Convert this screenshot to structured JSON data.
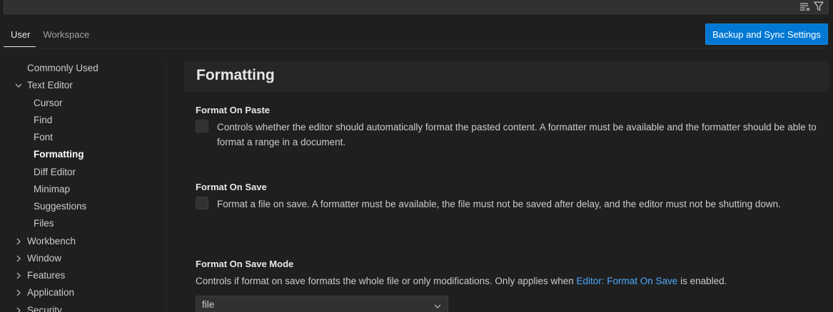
{
  "search": {
    "value": "",
    "clear_icon": "clear-filter-icon",
    "filter_icon": "filter-icon"
  },
  "tabs": [
    {
      "label": "User",
      "active": true
    },
    {
      "label": "Workspace",
      "active": false
    }
  ],
  "sync_button": {
    "label": "Backup and Sync Settings"
  },
  "toc": {
    "items": [
      {
        "label": "Commonly Used",
        "level": 0,
        "expandable": false
      },
      {
        "label": "Text Editor",
        "level": 0,
        "expandable": true,
        "expanded": true
      },
      {
        "label": "Cursor",
        "level": 1
      },
      {
        "label": "Find",
        "level": 1
      },
      {
        "label": "Font",
        "level": 1
      },
      {
        "label": "Formatting",
        "level": 1,
        "selected": true
      },
      {
        "label": "Diff Editor",
        "level": 1
      },
      {
        "label": "Minimap",
        "level": 1
      },
      {
        "label": "Suggestions",
        "level": 1
      },
      {
        "label": "Files",
        "level": 1
      },
      {
        "label": "Workbench",
        "level": 0,
        "expandable": true,
        "expanded": false
      },
      {
        "label": "Window",
        "level": 0,
        "expandable": true,
        "expanded": false
      },
      {
        "label": "Features",
        "level": 0,
        "expandable": true,
        "expanded": false
      },
      {
        "label": "Application",
        "level": 0,
        "expandable": true,
        "expanded": false
      },
      {
        "label": "Security",
        "level": 0,
        "expandable": true,
        "expanded": false
      }
    ]
  },
  "section": {
    "title": "Formatting"
  },
  "settings": {
    "format_on_paste": {
      "title": "Format On Paste",
      "checked": false,
      "description": "Controls whether the editor should automatically format the pasted content. A formatter must be available and the formatter should be able to format a range in a document."
    },
    "format_on_save": {
      "title": "Format On Save",
      "checked": false,
      "description": "Format a file on save. A formatter must be available, the file must not be saved after delay, and the editor must not be shutting down."
    },
    "format_on_save_mode": {
      "title": "Format On Save Mode",
      "description_before": "Controls if format on save formats the whole file or only modifications. Only applies when ",
      "description_link": "Editor: Format On Save",
      "description_after": " is enabled.",
      "value": "file"
    }
  },
  "colors": {
    "background": "#1f1f1f",
    "accent_button": "#0078d4",
    "link": "#4daafc"
  }
}
